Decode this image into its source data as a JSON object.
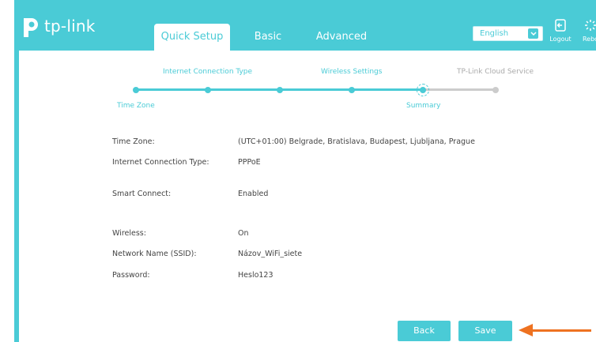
{
  "header": {
    "logo_text": "tp-link",
    "tabs": [
      {
        "label": "Quick Setup",
        "active": true
      },
      {
        "label": "Basic",
        "active": false
      },
      {
        "label": "Advanced",
        "active": false
      }
    ],
    "language": "English",
    "logout_label": "Logout",
    "reboot_label": "Rebo"
  },
  "progress": {
    "steps_top": [
      "Internet Connection Type",
      "Wireless Settings",
      "TP-Link Cloud Service"
    ],
    "steps_bottom": [
      "Time Zone",
      "Summary"
    ]
  },
  "summary": {
    "rows": [
      {
        "label": "Time Zone:",
        "value": "(UTC+01:00) Belgrade, Bratislava, Budapest, Ljubljana, Prague"
      },
      {
        "label": "Internet Connection Type:",
        "value": "PPPoE"
      },
      {
        "label": "Smart Connect:",
        "value": "Enabled"
      },
      {
        "label": "Wireless:",
        "value": "On"
      },
      {
        "label": "Network Name (SSID):",
        "value": "Názov_WiFi_siete"
      },
      {
        "label": "Password:",
        "value": "Heslo123"
      }
    ]
  },
  "actions": {
    "back_label": "Back",
    "save_label": "Save"
  },
  "colors": {
    "accent": "#4acbd6",
    "arrow": "#ee7221",
    "inactive": "#c8c8c8"
  }
}
